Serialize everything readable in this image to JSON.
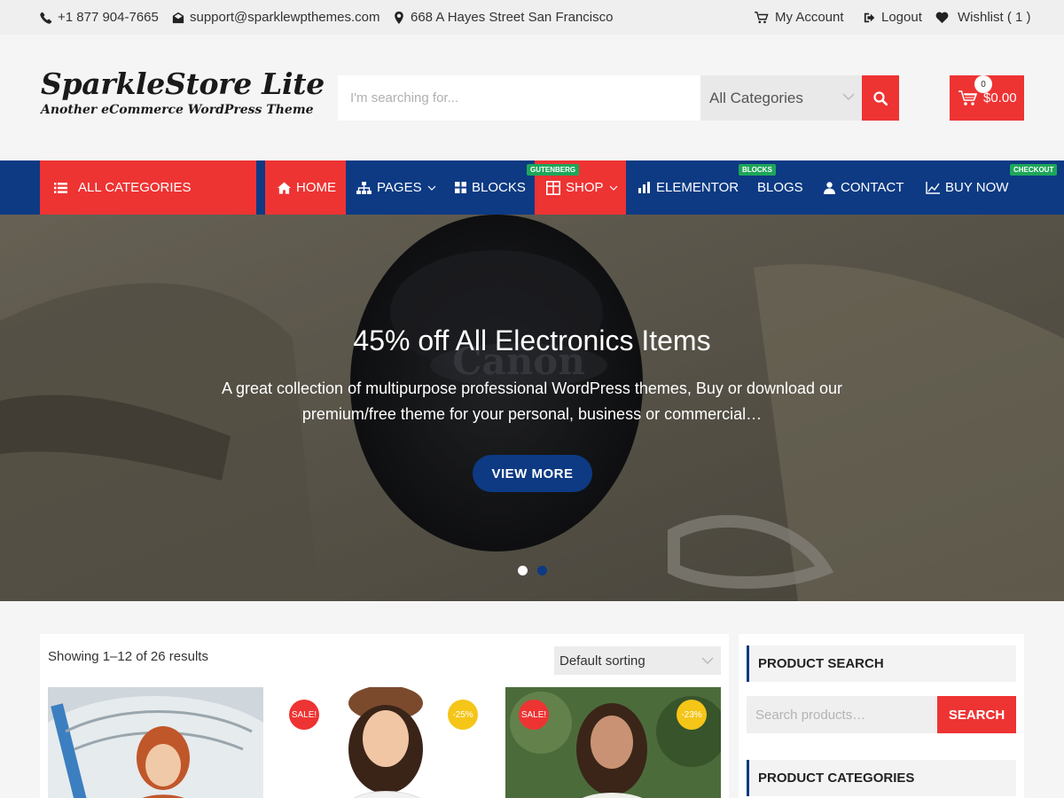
{
  "topbar": {
    "phone": "+1 877 904-7665",
    "email": "support@sparklewpthemes.com",
    "address": "668 A Hayes Street San Francisco",
    "my_account": "My Account",
    "logout": "Logout",
    "wishlist": "Wishlist ( 1 )"
  },
  "header": {
    "site_title": "SparkleStore Lite",
    "tagline": "Another eCommerce WordPress Theme",
    "search_placeholder": "I'm searching for...",
    "category_select": "All Categories",
    "cart_count": "0",
    "cart_total": "$0.00"
  },
  "nav": {
    "all_categories": "ALL CATEGORIES",
    "items": [
      {
        "label": "HOME",
        "icon": "home-icon"
      },
      {
        "label": "PAGES",
        "icon": "sitemap-icon"
      },
      {
        "label": "BLOCKS",
        "icon": "grid-icon"
      },
      {
        "label": "SHOP",
        "icon": "table-icon",
        "badge": "GUTENBERG"
      },
      {
        "label": "ELEMENTOR",
        "icon": "bar-chart-icon"
      },
      {
        "label": "BLOGS",
        "badge": "BLOCKS"
      },
      {
        "label": "CONTACT",
        "icon": "user-icon"
      },
      {
        "label": "BUY NOW",
        "icon": "line-chart-icon",
        "badge": "CHECKOUT"
      }
    ]
  },
  "hero": {
    "title": "45% off All Electronics Items",
    "text": "A great collection of multipurpose professional WordPress themes, Buy or download our premium/free theme for your personal, business or commercial…",
    "button": "VIEW MORE",
    "brand_lettering": "Canon",
    "slides": 2,
    "active_slide": 1
  },
  "shop": {
    "results": "Showing 1–12 of 26 results",
    "sorting": "Default sorting",
    "products": [
      {
        "badges": []
      },
      {
        "sale": "SALE!",
        "discount": "-25%"
      },
      {
        "sale": "SALE!",
        "discount": "-23%"
      }
    ]
  },
  "sidebar": {
    "product_search_title": "PRODUCT SEARCH",
    "search_placeholder": "Search products…",
    "search_button": "SEARCH",
    "product_categories_title": "PRODUCT CATEGORIES"
  },
  "colors": {
    "accent_red": "#ee3333",
    "nav_blue": "#0d3a83",
    "badge_green": "#1ea65a",
    "discount_yellow": "#f5c518"
  }
}
